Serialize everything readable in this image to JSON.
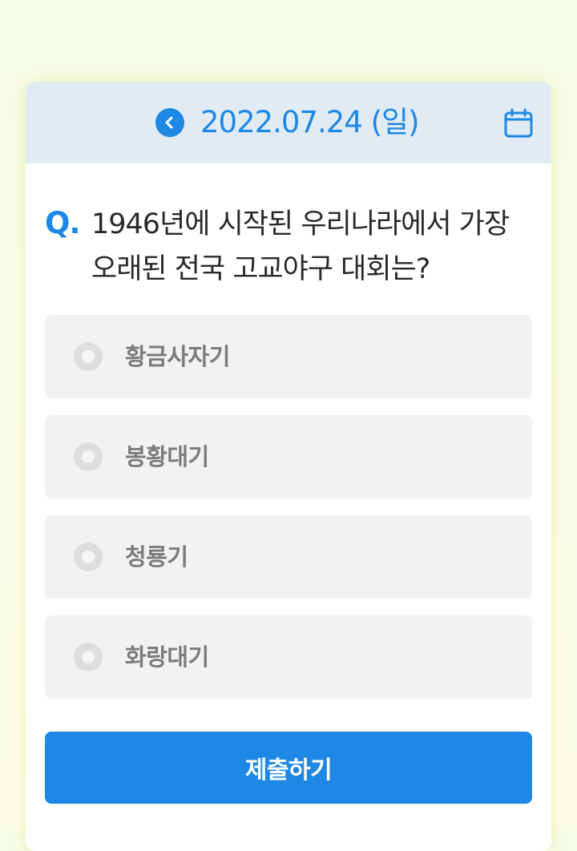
{
  "header": {
    "date": "2022.07.24 (일)",
    "prev_icon": "chevron-left-icon",
    "calendar_icon": "calendar-icon"
  },
  "question": {
    "marker": "Q.",
    "text": "1946년에 시작된 우리나라에서 가장 오래된 전국 고교야구 대회는?"
  },
  "options": [
    {
      "label": "황금사자기"
    },
    {
      "label": "봉황대기"
    },
    {
      "label": "청룡기"
    },
    {
      "label": "화랑대기"
    }
  ],
  "submit": {
    "label": "제출하기"
  },
  "colors": {
    "accent": "#1e88e5",
    "header_bg": "#e0ebf4",
    "option_bg": "#f2f2f2",
    "page_bg": "#f8fde7"
  }
}
